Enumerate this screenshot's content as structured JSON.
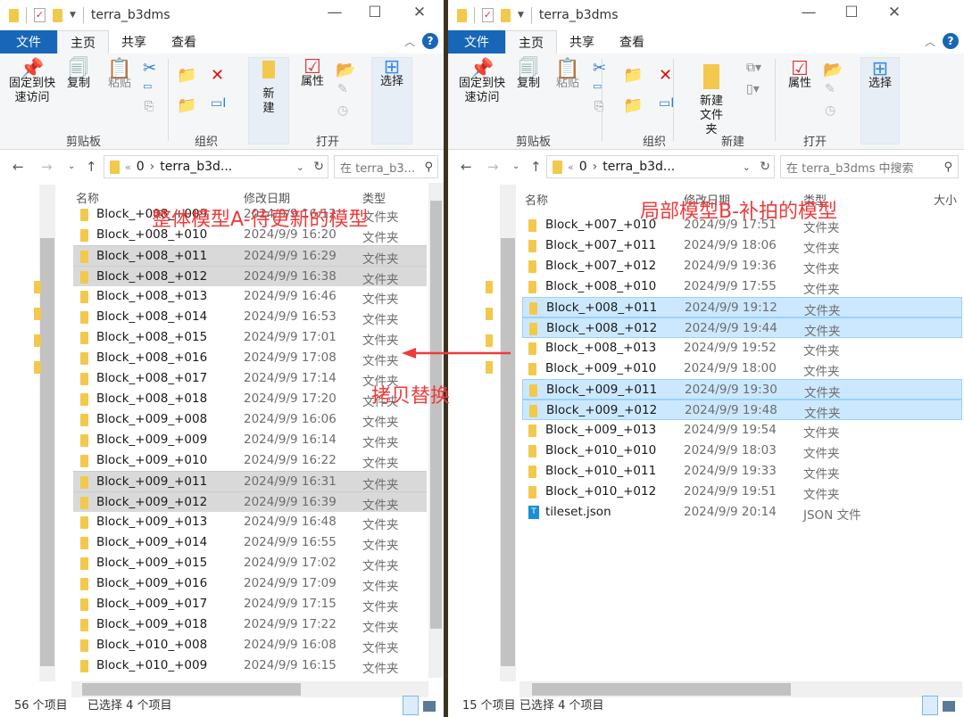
{
  "left": {
    "title": "terra_b3dms",
    "tabs": [
      "文件",
      "主页",
      "共享",
      "查看"
    ],
    "ribbon": {
      "pin": "固定到快速访问",
      "copy": "复制",
      "paste": "粘贴",
      "new": "新建",
      "properties": "属性",
      "select": "选择",
      "groups": [
        "剪贴板",
        "组织",
        "打开"
      ]
    },
    "address": {
      "prefix": "«",
      "crumb0": "0",
      "crumb1": "terra_b3d..."
    },
    "search_placeholder": "在 terra_b3...",
    "columns": [
      "名称",
      "修改日期",
      "类型"
    ],
    "rows": [
      {
        "name": "Block_+008_+009",
        "date": "2024/9/9 16:12",
        "type": "文件夹",
        "selected": false
      },
      {
        "name": "Block_+008_+010",
        "date": "2024/9/9 16:20",
        "type": "文件夹",
        "selected": false
      },
      {
        "name": "Block_+008_+011",
        "date": "2024/9/9 16:29",
        "type": "文件夹",
        "selected": true
      },
      {
        "name": "Block_+008_+012",
        "date": "2024/9/9 16:38",
        "type": "文件夹",
        "selected": true
      },
      {
        "name": "Block_+008_+013",
        "date": "2024/9/9 16:46",
        "type": "文件夹",
        "selected": false
      },
      {
        "name": "Block_+008_+014",
        "date": "2024/9/9 16:53",
        "type": "文件夹",
        "selected": false
      },
      {
        "name": "Block_+008_+015",
        "date": "2024/9/9 17:01",
        "type": "文件夹",
        "selected": false
      },
      {
        "name": "Block_+008_+016",
        "date": "2024/9/9 17:08",
        "type": "文件夹",
        "selected": false
      },
      {
        "name": "Block_+008_+017",
        "date": "2024/9/9 17:14",
        "type": "文件夹",
        "selected": false
      },
      {
        "name": "Block_+008_+018",
        "date": "2024/9/9 17:20",
        "type": "文件夹",
        "selected": false
      },
      {
        "name": "Block_+009_+008",
        "date": "2024/9/9 16:06",
        "type": "文件夹",
        "selected": false
      },
      {
        "name": "Block_+009_+009",
        "date": "2024/9/9 16:14",
        "type": "文件夹",
        "selected": false
      },
      {
        "name": "Block_+009_+010",
        "date": "2024/9/9 16:22",
        "type": "文件夹",
        "selected": false
      },
      {
        "name": "Block_+009_+011",
        "date": "2024/9/9 16:31",
        "type": "文件夹",
        "selected": true
      },
      {
        "name": "Block_+009_+012",
        "date": "2024/9/9 16:39",
        "type": "文件夹",
        "selected": true
      },
      {
        "name": "Block_+009_+013",
        "date": "2024/9/9 16:48",
        "type": "文件夹",
        "selected": false
      },
      {
        "name": "Block_+009_+014",
        "date": "2024/9/9 16:55",
        "type": "文件夹",
        "selected": false
      },
      {
        "name": "Block_+009_+015",
        "date": "2024/9/9 17:02",
        "type": "文件夹",
        "selected": false
      },
      {
        "name": "Block_+009_+016",
        "date": "2024/9/9 17:09",
        "type": "文件夹",
        "selected": false
      },
      {
        "name": "Block_+009_+017",
        "date": "2024/9/9 17:15",
        "type": "文件夹",
        "selected": false
      },
      {
        "name": "Block_+009_+018",
        "date": "2024/9/9 17:22",
        "type": "文件夹",
        "selected": false
      },
      {
        "name": "Block_+010_+008",
        "date": "2024/9/9 16:08",
        "type": "文件夹",
        "selected": false
      },
      {
        "name": "Block_+010_+009",
        "date": "2024/9/9 16:15",
        "type": "文件夹",
        "selected": false
      }
    ],
    "status": {
      "count": "56 个项目",
      "selected": "已选择 4 个项目"
    }
  },
  "right": {
    "title": "terra_b3dms",
    "tabs": [
      "文件",
      "主页",
      "共享",
      "查看"
    ],
    "ribbon": {
      "pin": "固定到快速访问",
      "copy": "复制",
      "paste": "粘贴",
      "new_folder": "新建文件夹",
      "properties": "属性",
      "select": "选择",
      "groups": [
        "剪贴板",
        "组织",
        "新建",
        "打开"
      ]
    },
    "address": {
      "prefix": "«",
      "crumb0": "0",
      "crumb1": "terra_b3d..."
    },
    "search_placeholder": "在 terra_b3dms 中搜索",
    "columns": [
      "名称",
      "修改日期",
      "类型",
      "大小"
    ],
    "rows": [
      {
        "name": "Block_+007_+010",
        "date": "2024/9/9 17:51",
        "type": "文件夹",
        "selected": false
      },
      {
        "name": "Block_+007_+011",
        "date": "2024/9/9 18:06",
        "type": "文件夹",
        "selected": false
      },
      {
        "name": "Block_+007_+012",
        "date": "2024/9/9 19:36",
        "type": "文件夹",
        "selected": false
      },
      {
        "name": "Block_+008_+010",
        "date": "2024/9/9 17:55",
        "type": "文件夹",
        "selected": false
      },
      {
        "name": "Block_+008_+011",
        "date": "2024/9/9 19:12",
        "type": "文件夹",
        "selected": true
      },
      {
        "name": "Block_+008_+012",
        "date": "2024/9/9 19:44",
        "type": "文件夹",
        "selected": true
      },
      {
        "name": "Block_+008_+013",
        "date": "2024/9/9 19:52",
        "type": "文件夹",
        "selected": false
      },
      {
        "name": "Block_+009_+010",
        "date": "2024/9/9 18:00",
        "type": "文件夹",
        "selected": false
      },
      {
        "name": "Block_+009_+011",
        "date": "2024/9/9 19:30",
        "type": "文件夹",
        "selected": true
      },
      {
        "name": "Block_+009_+012",
        "date": "2024/9/9 19:48",
        "type": "文件夹",
        "selected": true
      },
      {
        "name": "Block_+009_+013",
        "date": "2024/9/9 19:54",
        "type": "文件夹",
        "selected": false
      },
      {
        "name": "Block_+010_+010",
        "date": "2024/9/9 18:03",
        "type": "文件夹",
        "selected": false
      },
      {
        "name": "Block_+010_+011",
        "date": "2024/9/9 19:33",
        "type": "文件夹",
        "selected": false
      },
      {
        "name": "Block_+010_+012",
        "date": "2024/9/9 19:51",
        "type": "文件夹",
        "selected": false
      },
      {
        "name": "tileset.json",
        "date": "2024/9/9 20:14",
        "type": "JSON 文件",
        "selected": false,
        "icon": "json-file-icon"
      }
    ],
    "status": {
      "count": "15 个项目",
      "selected": "已选择 4 个项目"
    }
  },
  "annotations": {
    "left": "整体模型A-待更新的模型",
    "right": "局部模型B-补拍的模型",
    "arrow": "拷贝替换"
  },
  "colors": {
    "accent": "#1866b8",
    "annotation": "#ee3b3b",
    "selected_gray": "#d9d9d9",
    "selected_blue": "#cce8ff"
  }
}
